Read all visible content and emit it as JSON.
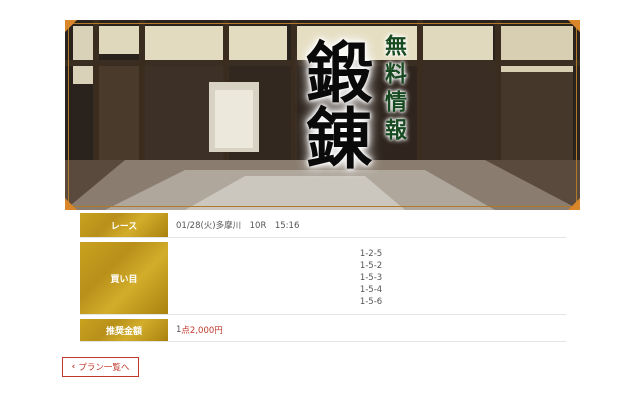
{
  "banner": {
    "title": "鍛錬",
    "subtitle": "無料情報"
  },
  "info": {
    "race": {
      "label": "レース",
      "value": "01/28(火)多摩川　10R　15:16"
    },
    "bets": {
      "label": "買い目",
      "items": [
        "1-2-5",
        "1-5-2",
        "1-5-3",
        "1-5-4",
        "1-5-6"
      ]
    },
    "amount": {
      "label": "推奨金額",
      "value_prefix": "1",
      "value_rest": "点2,000円"
    }
  },
  "back_button": {
    "label": "プラン一覧へ",
    "icon": "chevron-left-icon"
  },
  "colors": {
    "gold": "#c9a21f",
    "accent_red": "#c0392b"
  }
}
